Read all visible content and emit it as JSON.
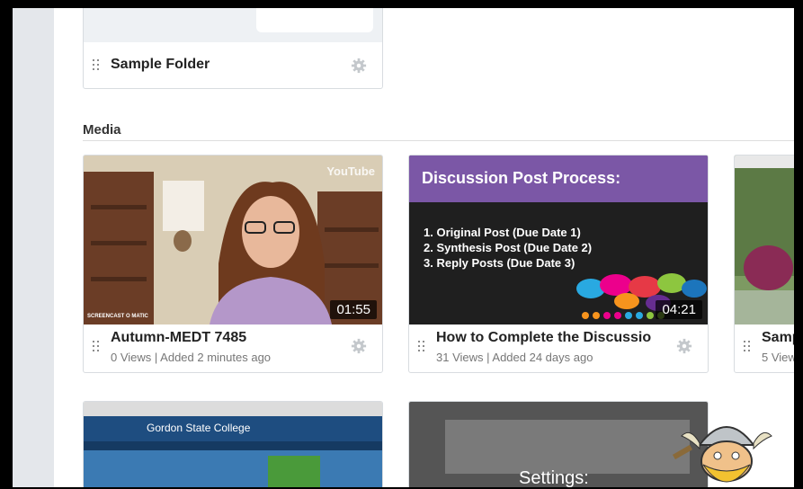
{
  "folder": {
    "name": "Sample Folder"
  },
  "media_section": {
    "title": "Media"
  },
  "media": [
    {
      "title": "Autumn-MEDT 7485",
      "meta": "0 Views | Added 2 minutes ago",
      "duration": "01:55",
      "youtube_badge": "YouTube",
      "watermark": "SCREENCAST O MATIC"
    },
    {
      "title": "How to Complete the Discussio",
      "meta": "31 Views | Added 24 days ago",
      "duration": "04:21",
      "slide": {
        "heading": "Discussion Post Process:",
        "steps": [
          "1.  Original Post (Due Date 1)",
          "2.  Synthesis Post (Due Date 2)",
          "3.  Reply Posts (Due Date 3)"
        ]
      }
    },
    {
      "title": "Samp",
      "meta": "5 View"
    }
  ],
  "lower": [
    {
      "site_name": "Gordon State College"
    },
    {
      "slide_text": "Settings:"
    }
  ],
  "colors": {
    "accent_purple": "#7b57a6",
    "slide_dark": "#1f1f1f",
    "sidebar": "#e4e7eb"
  }
}
